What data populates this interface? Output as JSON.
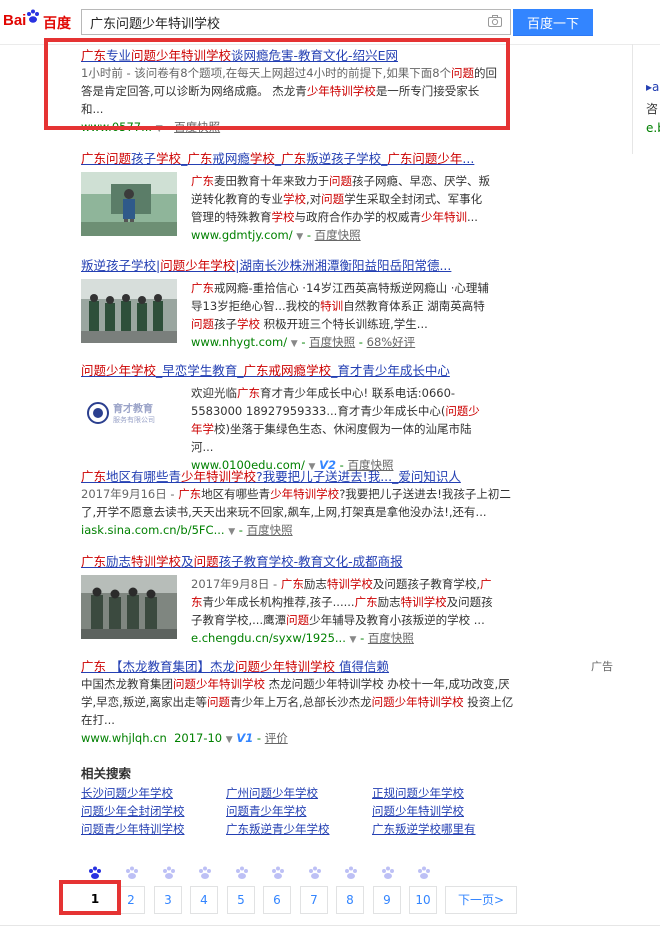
{
  "header": {
    "logo_bai": "Bai",
    "logo_du": "百度",
    "query": "广东问题少年特训学校",
    "search_button": "百度一下"
  },
  "right_panel": {
    "line1": "▸a",
    "line2": "咨",
    "line3": "e.b"
  },
  "results": [
    {
      "title": [
        "广东",
        "专业",
        "问题少年特训学校",
        "谈网瘾危害-教育文化-绍兴E网"
      ],
      "title_em": [
        true,
        false,
        true,
        false
      ],
      "abstract_parts": [
        "1小时前 - 该问卷有8个题项,在每天上网超过4小时的前提下,如果下面8个",
        "问题",
        "的回答是肯定回答,可以诊断为网络成瘾。 杰龙青",
        "少年特训学校",
        "是一所专门接受家长和..."
      ],
      "url": "www.0577...",
      "snap": "百度快照"
    },
    {
      "title": [
        "广东",
        "问题",
        "孩子",
        "学校",
        "_",
        "广东",
        "戒网瘾",
        "学校",
        "_",
        "广东",
        "叛逆孩子学校",
        "_",
        "广东问题少年",
        "..."
      ],
      "abstract_parts": [
        "广东",
        "麦田教育十年来致力于",
        "问题",
        "孩子网瘾、早恋、厌学、叛逆转化教育的专业",
        "学校",
        ",对",
        "问题",
        "学生采取全封闭式、军事化管理的特殊教育",
        "学校",
        "与政府合作办学的权威青",
        "少年特训",
        "..."
      ],
      "url": "www.gdmtjy.com/",
      "snap": "百度快照"
    },
    {
      "title": [
        "叛逆孩子学校|",
        "问题少年学校",
        "|湖南长沙株洲湘潭衡阳益阳岳阳常德..."
      ],
      "abstract_parts": [
        "广东",
        "戒网瘾-重拾信心 ·14岁江西英高特叛逆网瘾山 ·心理辅导13岁拒绝心智...我校的",
        "特训",
        "自然教育体系正 湖南英高特",
        "问题",
        "孩子",
        "学校",
        " 积极开班三个特长训练班,学生..."
      ],
      "url": "www.nhygt.com/",
      "snap": "百度快照",
      "rating": "68%好评"
    },
    {
      "title": [
        "问题少年学校",
        "_早恋学生教育_",
        "广东",
        "戒网瘾",
        "学校",
        "_育才青少年成长中心"
      ],
      "abstract_parts": [
        "欢迎光临",
        "广东",
        "育才青少年成长中心! 联系电话:0660-5583000 18927959333...育才青少年成长中心(",
        "问题少年学",
        "校",
        ")坐落于集绿色生态、休闲度假为一体的汕尾市陆河..."
      ],
      "url": "www.0100edu.com/",
      "v": "V2",
      "snap": "百度快照",
      "logo_text": "育才教育",
      "logo_sub": "服务有限公司"
    },
    {
      "title": [
        "广东",
        "地区有哪些青",
        "少年特训学校",
        "?我要把儿子送进去!我..._爱问知识人"
      ],
      "abstract_parts": [
        "2017年9月16日 - ",
        "广东",
        "地区有哪些青",
        "少年特训学校",
        "?我要把儿子送进去!我孩子上初二了,开学不愿意去读书,天天出来玩不回家,飙车,上网,打架真是拿他没办法!,还有..."
      ],
      "url": "iask.sina.com.cn/b/5FC...",
      "snap": "百度快照"
    },
    {
      "title": [
        "广东",
        "励志",
        "特训学校",
        "及",
        "问题",
        "孩子教育学校-教育文化-成都商报"
      ],
      "abstract_parts": [
        "2017年9月8日 - ",
        "广东",
        "励志",
        "特训学校",
        "及问题孩子教育学校,",
        "广东",
        "青少年成长机构推荐,孩子......",
        "广东",
        "励志",
        "特训学校",
        "及问题孩子教育学校,...鹰潭",
        "问题",
        "少年辅导及教育小孩叛逆的学校 ..."
      ],
      "url": "e.chengdu.cn/syxw/1925...",
      "snap": "百度快照"
    },
    {
      "title": [
        "广东",
        " 【杰龙教育集团】杰龙",
        "问题少年特训学校",
        " 值得信赖"
      ],
      "abstract_parts": [
        "中国杰龙教育集团",
        "问题少年特训学校",
        " 杰龙问题少年特训学校 办校十一年,成功改变,厌学,早恋,叛逆,离家出走等",
        "问题",
        "青少年上万名,总部长沙杰龙",
        "问题少年特训学校",
        " 投资上亿在打..."
      ],
      "url": "www.whjlqh.cn",
      "date": "2017-10",
      "v": "V1",
      "rating": "评价",
      "ad": "广告"
    }
  ],
  "related": {
    "heading": "相关搜索",
    "items": [
      "长沙问题少年学校",
      "广州问题少年学校",
      "正规问题少年学校",
      "问题少年全封闭学校",
      "问题青少年学校",
      "问题少年特训学校",
      "问题青少年特训学校",
      "广东叛逆青少年学校",
      "广东叛逆学校哪里有"
    ]
  },
  "pager": {
    "pages": [
      "1",
      "2",
      "3",
      "4",
      "5",
      "6",
      "7",
      "8",
      "9",
      "10"
    ],
    "current": "1",
    "next": "下一页>"
  }
}
